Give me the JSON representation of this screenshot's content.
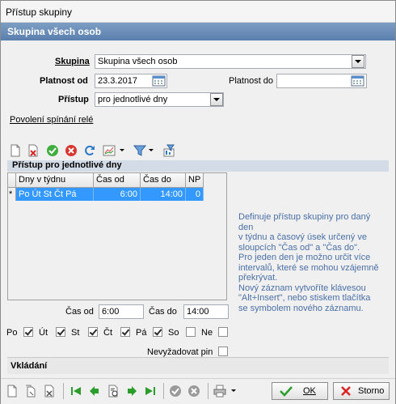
{
  "window": {
    "title": "Přístup skupiny"
  },
  "header": {
    "title": "Skupina všech osob"
  },
  "form": {
    "group_label": "Skupina",
    "group_value": "Skupina všech osob",
    "valid_from_label": "Platnost od",
    "valid_from_value": "23.3.2017",
    "valid_to_label": "Platnost do",
    "valid_to_value": "",
    "access_label": "Přístup",
    "access_value": "pro jednotlivé dny",
    "relay_link": "Povolení spínání relé"
  },
  "section": {
    "title": "Přístup pro jednotlivé dny"
  },
  "grid": {
    "columns": [
      "Dny v týdnu",
      "Čas od",
      "Čas do",
      "NP"
    ],
    "rows": [
      {
        "marker": "*",
        "days": "Po Út St Čt Pá",
        "from": "6:00",
        "to": "14:00",
        "np": "0"
      }
    ]
  },
  "help_lines": [
    "Definuje přístup skupiny pro daný",
    "den",
    "v týdnu a časový úsek určený ve",
    "sloupcích \"Čas od\" a \"Čas do\".",
    "Pro jeden den je možno určit více",
    "intervalů, které se mohou vzájemně",
    "překrývat.",
    "Nový záznam vytvoříte klávesou",
    "\"Alt+Insert\", nebo stiskem tlačítka",
    "se symbolem nového  záznamu."
  ],
  "time": {
    "from_label": "Čas od",
    "from_value": "6:00",
    "to_label": "Čas do",
    "to_value": "14:00"
  },
  "days": [
    {
      "label": "Po",
      "checked": true
    },
    {
      "label": "Út",
      "checked": true
    },
    {
      "label": "St",
      "checked": true
    },
    {
      "label": "Čt",
      "checked": true
    },
    {
      "label": "Pá",
      "checked": true
    },
    {
      "label": "So",
      "checked": false
    },
    {
      "label": "Ne",
      "checked": false
    }
  ],
  "no_pin": {
    "label": "Nevyžadovat pin",
    "checked": false
  },
  "bottom": {
    "title": "Vkládání"
  },
  "buttons": {
    "ok": "OK",
    "cancel": "Storno"
  },
  "colors": {
    "header": "#5a7fae",
    "selection": "#3399ff",
    "help_text": "#4a6fa5"
  }
}
